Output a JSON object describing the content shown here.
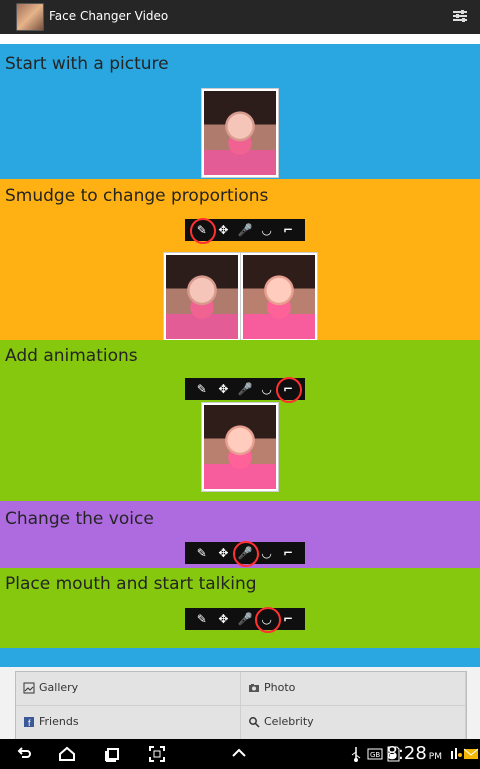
{
  "app": {
    "title": "Face Changer Video"
  },
  "sections": [
    {
      "title": "Start with a picture",
      "color": "#2aa7e0"
    },
    {
      "title": "Smudge to change proportions",
      "color": "#ffb012"
    },
    {
      "title": "Add animations",
      "color": "#85c80d"
    },
    {
      "title": "Change the voice",
      "color": "#ae6adf"
    },
    {
      "title": "Place mouth and start talking",
      "color": "#85c80d"
    }
  ],
  "tools": [
    "smudge-icon",
    "move-icon",
    "microphone-icon",
    "mouth-icon",
    "glasses-icon"
  ],
  "bottom": {
    "gallery": "Gallery",
    "photo": "Photo",
    "friends": "Friends",
    "celebrity": "Celebrity"
  },
  "status": {
    "time": "8:28",
    "period": "PM"
  }
}
